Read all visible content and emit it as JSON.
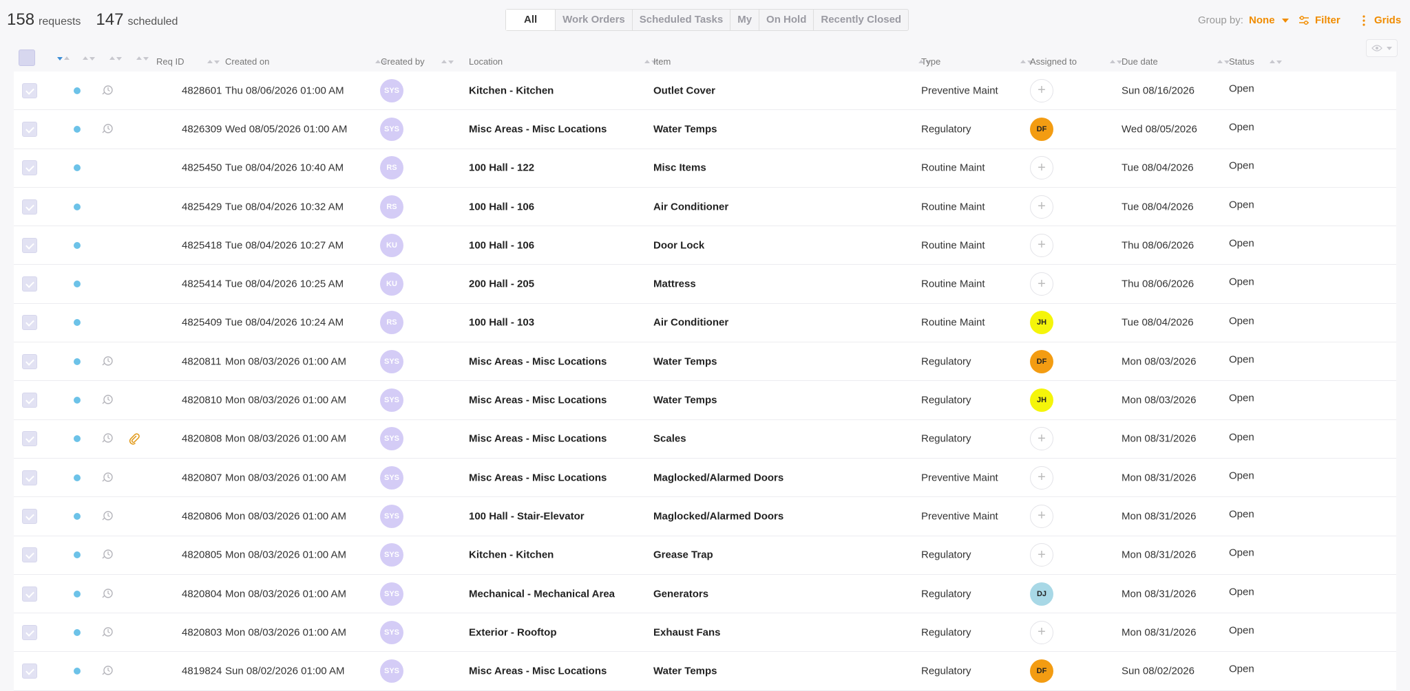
{
  "header": {
    "requests_count": "158",
    "requests_label": "requests",
    "scheduled_count": "147",
    "scheduled_label": "scheduled",
    "tabs": [
      {
        "label": "All",
        "active": true
      },
      {
        "label": "Work Orders",
        "active": false
      },
      {
        "label": "Scheduled Tasks",
        "active": false
      },
      {
        "label": "My",
        "active": false
      },
      {
        "label": "On Hold",
        "active": false
      },
      {
        "label": "Recently Closed",
        "active": false
      }
    ],
    "group_by_label": "Group by:",
    "group_by_value": "None",
    "filter_label": "Filter",
    "grids_label": "Grids"
  },
  "columns": {
    "req_id": "Req ID",
    "created_on": "Created on",
    "created_by": "Created by",
    "location": "Location",
    "item": "Item",
    "type": "Type",
    "assigned_to": "Assigned to",
    "due_date": "Due date",
    "status": "Status"
  },
  "colors": {
    "accent": "#f08c00",
    "dot": "#6cc2e8",
    "avatar_creator": "#d4ccf6",
    "assignee_df": "#f39c12",
    "assignee_jh": "#f5f50a",
    "assignee_dj": "#a8d8e6"
  },
  "rows": [
    {
      "req_id": "4828601",
      "created": "Thu 08/06/2026 01:00 AM",
      "creator": "SYS",
      "location": "Kitchen - Kitchen",
      "item": "Outlet Cover",
      "type": "Preventive Maint",
      "assignee": "",
      "assignee_color": "",
      "due": "Sun 08/16/2026",
      "status": "Open",
      "recurring": true,
      "attachment": false
    },
    {
      "req_id": "4826309",
      "created": "Wed 08/05/2026 01:00 AM",
      "creator": "SYS",
      "location": "Misc Areas - Misc Locations",
      "item": "Water Temps",
      "type": "Regulatory",
      "assignee": "DF",
      "assignee_color": "#f39c12",
      "due": "Wed 08/05/2026",
      "status": "Open",
      "recurring": true,
      "attachment": false
    },
    {
      "req_id": "4825450",
      "created": "Tue 08/04/2026 10:40 AM",
      "creator": "RS",
      "location": "100 Hall - 122",
      "item": "Misc Items",
      "type": "Routine Maint",
      "assignee": "",
      "assignee_color": "",
      "due": "Tue 08/04/2026",
      "status": "Open",
      "recurring": false,
      "attachment": false
    },
    {
      "req_id": "4825429",
      "created": "Tue 08/04/2026 10:32 AM",
      "creator": "RS",
      "location": "100 Hall - 106",
      "item": "Air Conditioner",
      "type": "Routine Maint",
      "assignee": "",
      "assignee_color": "",
      "due": "Tue 08/04/2026",
      "status": "Open",
      "recurring": false,
      "attachment": false
    },
    {
      "req_id": "4825418",
      "created": "Tue 08/04/2026 10:27 AM",
      "creator": "KU",
      "location": "100 Hall - 106",
      "item": "Door Lock",
      "type": "Routine Maint",
      "assignee": "",
      "assignee_color": "",
      "due": "Thu 08/06/2026",
      "status": "Open",
      "recurring": false,
      "attachment": false
    },
    {
      "req_id": "4825414",
      "created": "Tue 08/04/2026 10:25 AM",
      "creator": "KU",
      "location": "200 Hall - 205",
      "item": "Mattress",
      "type": "Routine Maint",
      "assignee": "",
      "assignee_color": "",
      "due": "Thu 08/06/2026",
      "status": "Open",
      "recurring": false,
      "attachment": false
    },
    {
      "req_id": "4825409",
      "created": "Tue 08/04/2026 10:24 AM",
      "creator": "RS",
      "location": "100 Hall - 103",
      "item": "Air Conditioner",
      "type": "Routine Maint",
      "assignee": "JH",
      "assignee_color": "#f5f50a",
      "due": "Tue 08/04/2026",
      "status": "Open",
      "recurring": false,
      "attachment": false
    },
    {
      "req_id": "4820811",
      "created": "Mon 08/03/2026 01:00 AM",
      "creator": "SYS",
      "location": "Misc Areas - Misc Locations",
      "item": "Water Temps",
      "type": "Regulatory",
      "assignee": "DF",
      "assignee_color": "#f39c12",
      "due": "Mon 08/03/2026",
      "status": "Open",
      "recurring": true,
      "attachment": false
    },
    {
      "req_id": "4820810",
      "created": "Mon 08/03/2026 01:00 AM",
      "creator": "SYS",
      "location": "Misc Areas - Misc Locations",
      "item": "Water Temps",
      "type": "Regulatory",
      "assignee": "JH",
      "assignee_color": "#f5f50a",
      "due": "Mon 08/03/2026",
      "status": "Open",
      "recurring": true,
      "attachment": false
    },
    {
      "req_id": "4820808",
      "created": "Mon 08/03/2026 01:00 AM",
      "creator": "SYS",
      "location": "Misc Areas - Misc Locations",
      "item": "Scales",
      "type": "Regulatory",
      "assignee": "",
      "assignee_color": "",
      "due": "Mon 08/31/2026",
      "status": "Open",
      "recurring": true,
      "attachment": true
    },
    {
      "req_id": "4820807",
      "created": "Mon 08/03/2026 01:00 AM",
      "creator": "SYS",
      "location": "Misc Areas - Misc Locations",
      "item": "Maglocked/Alarmed Doors",
      "type": "Preventive Maint",
      "assignee": "",
      "assignee_color": "",
      "due": "Mon 08/31/2026",
      "status": "Open",
      "recurring": true,
      "attachment": false
    },
    {
      "req_id": "4820806",
      "created": "Mon 08/03/2026 01:00 AM",
      "creator": "SYS",
      "location": "100 Hall - Stair-Elevator",
      "item": "Maglocked/Alarmed Doors",
      "type": "Preventive Maint",
      "assignee": "",
      "assignee_color": "",
      "due": "Mon 08/31/2026",
      "status": "Open",
      "recurring": true,
      "attachment": false
    },
    {
      "req_id": "4820805",
      "created": "Mon 08/03/2026 01:00 AM",
      "creator": "SYS",
      "location": "Kitchen - Kitchen",
      "item": "Grease Trap",
      "type": "Regulatory",
      "assignee": "",
      "assignee_color": "",
      "due": "Mon 08/31/2026",
      "status": "Open",
      "recurring": true,
      "attachment": false
    },
    {
      "req_id": "4820804",
      "created": "Mon 08/03/2026 01:00 AM",
      "creator": "SYS",
      "location": "Mechanical - Mechanical Area",
      "item": "Generators",
      "type": "Regulatory",
      "assignee": "DJ",
      "assignee_color": "#a8d8e6",
      "due": "Mon 08/31/2026",
      "status": "Open",
      "recurring": true,
      "attachment": false
    },
    {
      "req_id": "4820803",
      "created": "Mon 08/03/2026 01:00 AM",
      "creator": "SYS",
      "location": "Exterior - Rooftop",
      "item": "Exhaust Fans",
      "type": "Regulatory",
      "assignee": "",
      "assignee_color": "",
      "due": "Mon 08/31/2026",
      "status": "Open",
      "recurring": true,
      "attachment": false
    },
    {
      "req_id": "4819824",
      "created": "Sun 08/02/2026 01:00 AM",
      "creator": "SYS",
      "location": "Misc Areas - Misc Locations",
      "item": "Water Temps",
      "type": "Regulatory",
      "assignee": "DF",
      "assignee_color": "#f39c12",
      "due": "Sun 08/02/2026",
      "status": "Open",
      "recurring": true,
      "attachment": false
    }
  ]
}
